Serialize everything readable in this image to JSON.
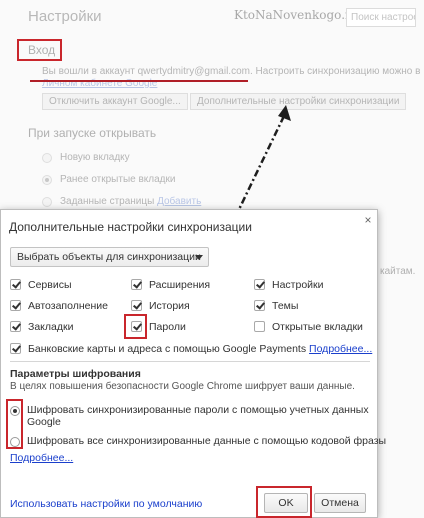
{
  "background": {
    "title": "Настройки",
    "watermark": "KtoNaNovenkogo.ru",
    "search_placeholder": "Поиск настроек",
    "signin_heading": "Вход",
    "signed_in_prefix": "Вы вошли в аккаунт ",
    "account_email": "qwertydmitry@gmail.com",
    "signed_in_suffix": ". Настроить синхронизацию можно в",
    "dashboard_link": "Личном кабинете Google",
    "disconnect_button": "Отключить аккаунт Google...",
    "advanced_sync_button": "Дополнительные настройки синхронизации",
    "startup_heading": "При запуске открывать",
    "startup_options": [
      "Новую вкладку",
      "Ранее открытые вкладки",
      "Заданные страницы"
    ],
    "startup_add_link": "Добавить",
    "side_text": "кайтам."
  },
  "dialog": {
    "title": "Дополнительные настройки синхронизации",
    "close_glyph": "×",
    "sync_select_value": "Выбрать объекты для синхронизации",
    "items": [
      {
        "label": "Сервисы",
        "checked": true
      },
      {
        "label": "Расширения",
        "checked": true
      },
      {
        "label": "Настройки",
        "checked": true
      },
      {
        "label": "Автозаполнение",
        "checked": true
      },
      {
        "label": "История",
        "checked": true
      },
      {
        "label": "Темы",
        "checked": true
      },
      {
        "label": "Закладки",
        "checked": true
      },
      {
        "label": "Пароли",
        "checked": true
      },
      {
        "label": "Открытые вкладки",
        "checked": false
      }
    ],
    "payments_label": "Банковские карты и адреса с помощью Google Payments",
    "payments_checked": true,
    "more_link": "Подробнее...",
    "encryption_heading": "Параметры шифрования",
    "encryption_desc": "В целях повышения безопасности Google Chrome шифрует ваши данные.",
    "encrypt_google_label": "Шифровать синхронизированные пароли с помощью учетных данных Google",
    "encrypt_passphrase_label": "Шифровать все синхронизированные данные с помощью кодовой фразы",
    "encryption_more_link": "Подробнее...",
    "defaults_link": "Использовать настройки по умолчанию",
    "ok_button": "OK",
    "cancel_button": "Отмена"
  },
  "colors": {
    "annotation_red": "#c9262c",
    "link_blue": "#1a3fcc"
  }
}
